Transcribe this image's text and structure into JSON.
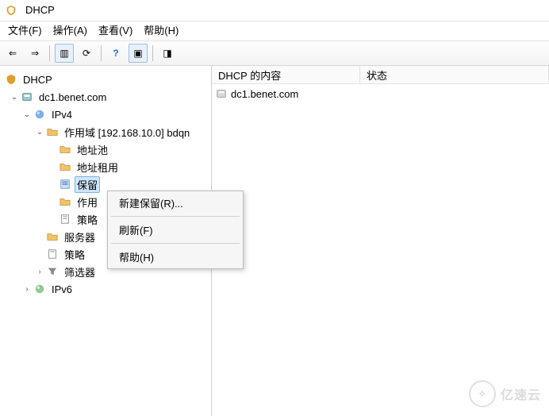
{
  "window": {
    "title": "DHCP"
  },
  "menu": {
    "file": "文件(F)",
    "action": "操作(A)",
    "view": "查看(V)",
    "help": "帮助(H)"
  },
  "toolbar_icons": {
    "back": "⇐",
    "forward": "⇒",
    "panes": "▥",
    "refresh": "⟳",
    "help": "?",
    "console": "▣",
    "server": "◨"
  },
  "tree": {
    "root": "DHCP",
    "server": "dc1.benet.com",
    "ipv4": "IPv4",
    "scope": "作用域 [192.168.10.0] bdqn",
    "pool": "地址池",
    "lease": "地址租用",
    "reservation": "保留",
    "scope_options": "作用",
    "policies_sub": "策略",
    "server_options": "服务器",
    "policies_top": "策略",
    "filters": "筛选器",
    "ipv6": "IPv6"
  },
  "list": {
    "header_name": "DHCP 的内容",
    "header_status": "状态",
    "rows": [
      {
        "name": "dc1.benet.com"
      }
    ]
  },
  "context_menu": {
    "new_reservation": "新建保留(R)...",
    "refresh": "刷新(F)",
    "help": "帮助(H)"
  },
  "watermark": {
    "text": "亿速云"
  }
}
